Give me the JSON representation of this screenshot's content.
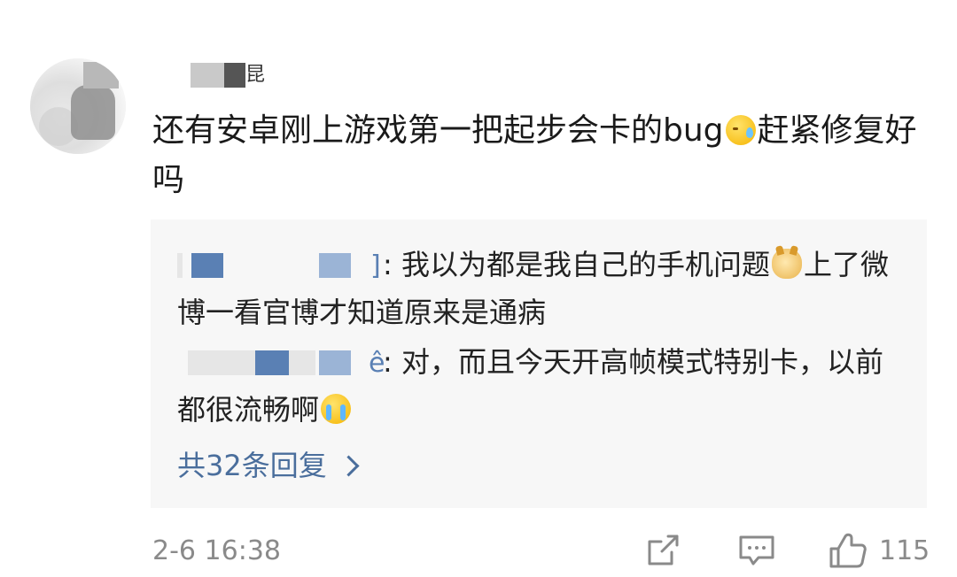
{
  "comment": {
    "username_visible_suffix": "昆",
    "text_before_emoji": "还有安卓刚上游戏第一把起步会卡的bug",
    "emoji_1": "sweat-emoji",
    "text_after_emoji": "赶紧修复好吗"
  },
  "replies": {
    "items": [
      {
        "name_suffix": "]",
        "separator": ":",
        "text_before_emoji": " 我以为都是我自己的手机问题",
        "emoji": "doge-emoji",
        "text_after_emoji": "上了微博一看官博才知道原来是通病"
      },
      {
        "name_suffix": "ê",
        "separator": ":",
        "text_before_emoji": " 对，而且今天开高帧模式特别卡，以前都很流畅啊",
        "emoji": "crying-emoji",
        "text_after_emoji": ""
      }
    ],
    "more_label": "共32条回复"
  },
  "footer": {
    "timestamp": "2-6 16:38",
    "like_count": "115"
  },
  "colors": {
    "link": "#4a6e9c",
    "reply_bg": "#f7f7f7",
    "muted": "#8a8a8a"
  }
}
